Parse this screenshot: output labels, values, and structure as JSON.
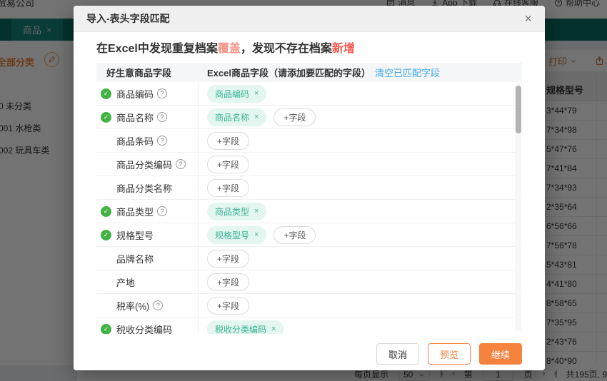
{
  "modal": {
    "title": "导入-表头字段匹配",
    "close_glyph": "×",
    "notice": {
      "part1": "在Excel中发现重复档案",
      "highlight_cover": "覆盖",
      "part2": "，发现不存在档案",
      "highlight_add": "新增"
    },
    "table": {
      "col1_header": "好生意商品字段",
      "col2_header": "Excel商品字段（请添加要匹配的字段）",
      "clear_link": "清空已匹配字段",
      "add_field_label": "+字段",
      "rows": [
        {
          "label": "商品编码",
          "matched": true,
          "help": true,
          "tag": "商品编码",
          "add_field": false
        },
        {
          "label": "商品名称",
          "matched": true,
          "help": true,
          "tag": "商品名称",
          "add_field": true
        },
        {
          "label": "商品条码",
          "matched": false,
          "help": true,
          "tag": null,
          "add_field": true
        },
        {
          "label": "商品分类编码",
          "matched": false,
          "help": true,
          "tag": null,
          "add_field": true
        },
        {
          "label": "商品分类名称",
          "matched": false,
          "help": false,
          "tag": null,
          "add_field": true
        },
        {
          "label": "商品类型",
          "matched": true,
          "help": true,
          "tag": "商品类型",
          "add_field": false
        },
        {
          "label": "规格型号",
          "matched": true,
          "help": false,
          "tag": "规格型号",
          "add_field": true
        },
        {
          "label": "品牌名称",
          "matched": false,
          "help": false,
          "tag": null,
          "add_field": true
        },
        {
          "label": "产地",
          "matched": false,
          "help": false,
          "tag": null,
          "add_field": true
        },
        {
          "label": "税率(%)",
          "matched": false,
          "help": true,
          "tag": null,
          "add_field": true
        },
        {
          "label": "税收分类编码",
          "matched": true,
          "help": false,
          "tag": "税收分类编码",
          "add_field": false
        }
      ]
    },
    "footer": {
      "cancel": "取消",
      "preview": "预览",
      "continue": "继续"
    }
  },
  "background": {
    "header": {
      "company": "贸易公司",
      "nav": [
        {
          "label": "消息"
        },
        {
          "label": "App 下载"
        },
        {
          "label": "在线客服"
        },
        {
          "label": "帮助中心"
        }
      ]
    },
    "tab": {
      "label": "商品",
      "close_glyph": "×"
    },
    "sidebar": {
      "title": "全部分类",
      "items": [
        "0 未分类",
        "001 水枪类",
        "002 玩具车类"
      ]
    },
    "toolbar": {
      "print": "打印",
      "export": "导出"
    },
    "list": {
      "column_header": "规格型号",
      "values": [
        "3*44*79",
        "7*34*98",
        "5*47*76",
        "7*41*84",
        "7*34*93",
        "2*35*64",
        "6*56*66",
        "7*56*78",
        "5*43*81",
        "4*41*80",
        "8*58*65",
        "7*35*95",
        "2*43*76",
        "8*40*90"
      ]
    },
    "pagination": {
      "per_page_label": "每页显示",
      "per_page": "50",
      "first": "|‹",
      "prev": "‹",
      "page_label_pre": "第",
      "page": "1",
      "page_label_post": "页",
      "next": "›",
      "last": "›|",
      "total": "共195页, 9"
    }
  },
  "colors": {
    "accent_orange": "#f5823d",
    "brand_teal_bar": "#0a6e62",
    "tag_teal": "#35b392",
    "check_green": "#43b244",
    "alert_red": "#f5564a",
    "link_blue": "#3ea8e8"
  }
}
